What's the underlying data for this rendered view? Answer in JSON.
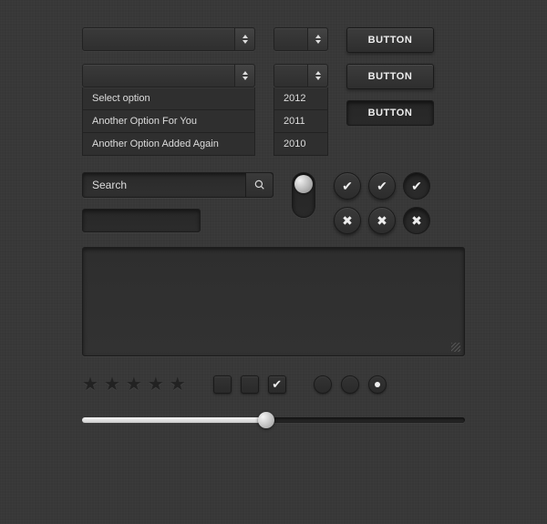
{
  "select1": {
    "label": "",
    "options": [
      "Select option",
      "Another Option For You",
      "Another Option Added Again"
    ]
  },
  "select2": {
    "label": "",
    "options": [
      "2012",
      "2011",
      "2010"
    ]
  },
  "buttons": {
    "b1": "BUTTON",
    "b2": "BUTTON",
    "b3": "BUTTON"
  },
  "search": {
    "placeholder": "Search"
  },
  "toggle": {
    "on": true
  },
  "iconButtons": {
    "check": "✔",
    "cross": "✖"
  },
  "stars": {
    "count": 5,
    "rating": 0
  },
  "checkboxes": {
    "c1": false,
    "c2": false,
    "c3": true,
    "checkGlyph": "✔"
  },
  "radios": {
    "r1": false,
    "r2": false,
    "r3": true
  },
  "slider": {
    "value": 48,
    "min": 0,
    "max": 100
  },
  "colors": {
    "bg": "#373737",
    "panel": "#2f2f2f",
    "text": "#dddddd"
  }
}
